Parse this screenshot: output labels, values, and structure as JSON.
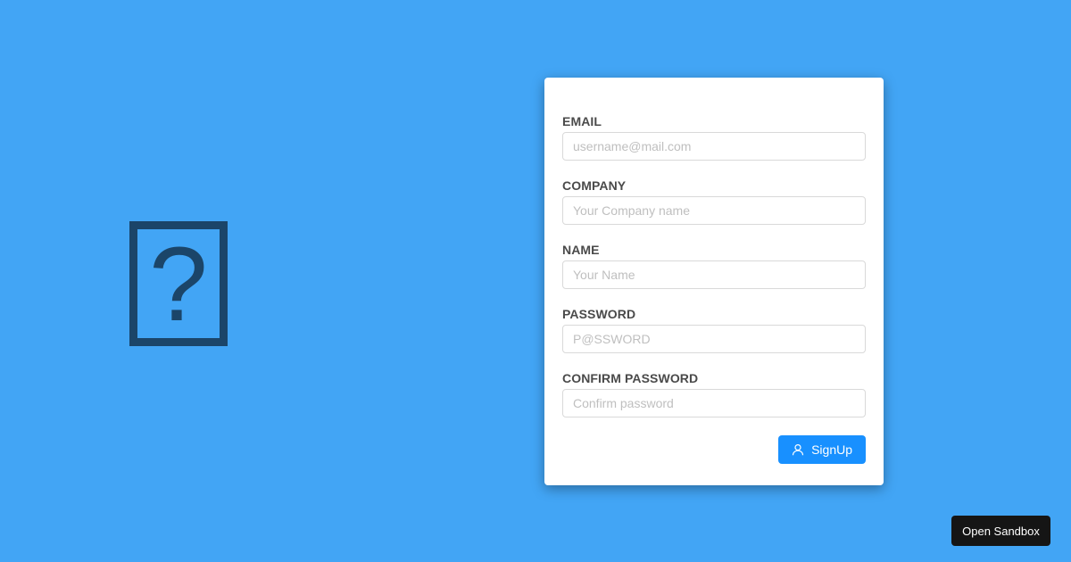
{
  "hero": {
    "glyph": "?"
  },
  "form": {
    "fields": [
      {
        "label": "EMAIL",
        "placeholder": "username@mail.com",
        "value": ""
      },
      {
        "label": "COMPANY",
        "placeholder": "Your Company name",
        "value": ""
      },
      {
        "label": "NAME",
        "placeholder": "Your Name",
        "value": ""
      },
      {
        "label": "PASSWORD",
        "placeholder": "P@SSWORD",
        "value": ""
      },
      {
        "label": "CONFIRM PASSWORD",
        "placeholder": "Confirm password",
        "value": ""
      }
    ],
    "submit_label": "SignUp",
    "submit_icon": "user-icon"
  },
  "footer": {
    "sandbox_label": "Open Sandbox"
  },
  "colors": {
    "background": "#42a5f5",
    "primary": "#1890ff",
    "glyph": "#1b4569",
    "sandbox_button": "#151515"
  }
}
